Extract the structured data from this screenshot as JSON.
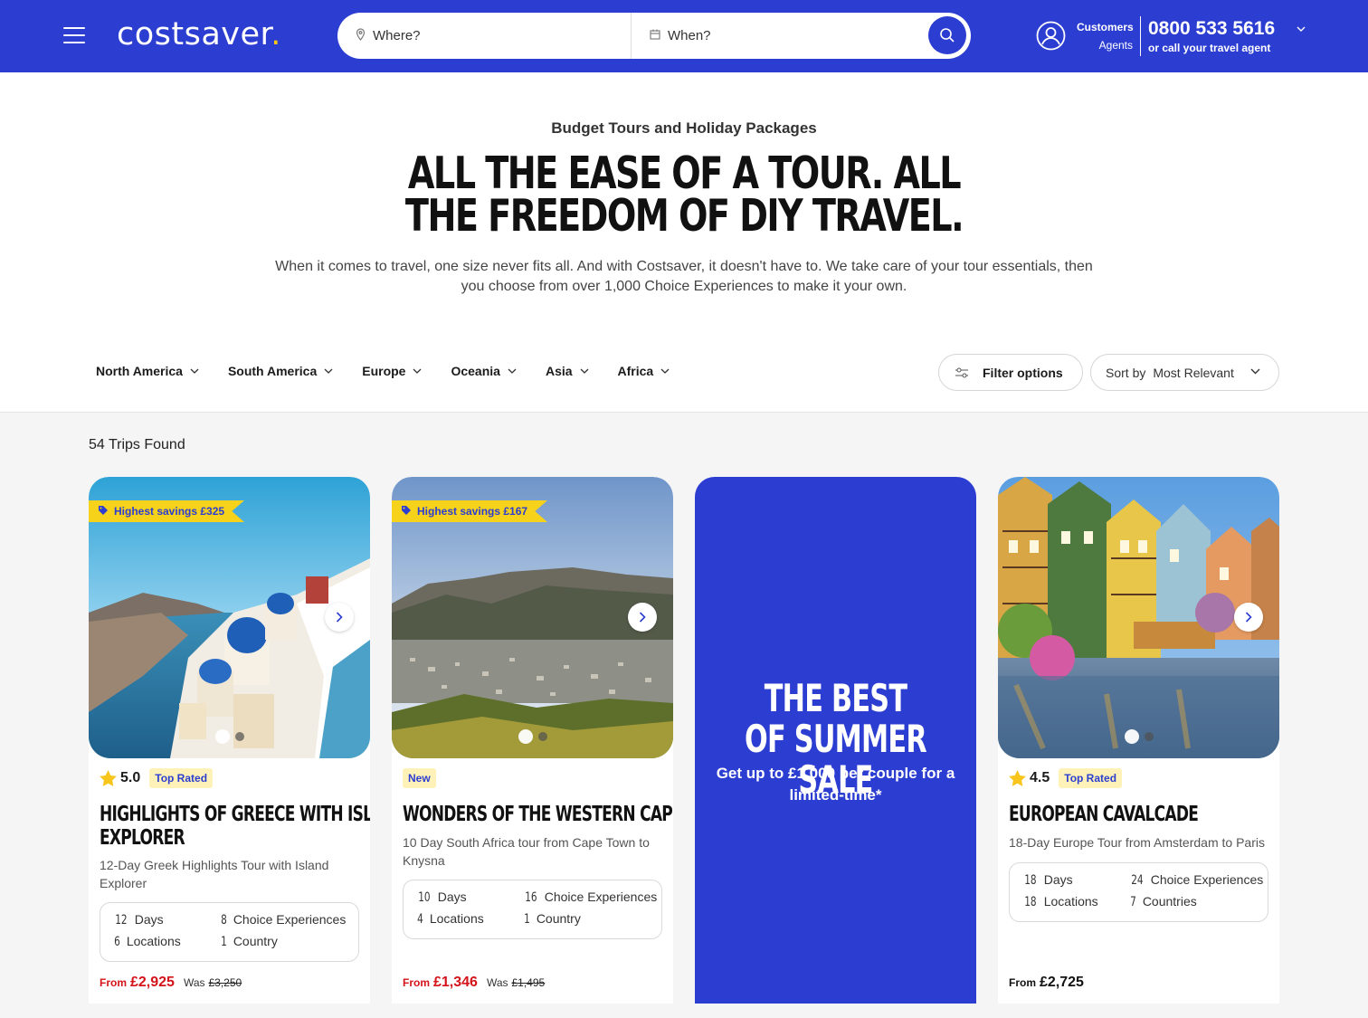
{
  "header": {
    "logo_text": "costsaver",
    "logo_dot": ".",
    "search": {
      "where_placeholder": "Where?",
      "when_placeholder": "When?"
    },
    "customers_label": "Customers",
    "agents_label": "Agents",
    "phone": "0800 533 5616",
    "phone_sub": "or call your travel agent"
  },
  "hero": {
    "eyebrow": "Budget Tours and Holiday Packages",
    "headline": "ALL THE EASE OF A TOUR. ALL THE FREEDOM OF DIY TRAVEL.",
    "lede": "When it comes to travel, one size never fits all. And with Costsaver, it doesn't have to. We take care of your tour essentials, then you choose from over 1,000 Choice Experiences to make it your own."
  },
  "filters": {
    "regions": [
      "North America",
      "South America",
      "Europe",
      "Oceania",
      "Asia",
      "Africa"
    ],
    "filter_label": "Filter options",
    "sort_label": "Sort by",
    "sort_value": "Most Relevant"
  },
  "results": {
    "count_label": "54 Trips Found",
    "cards": [
      {
        "ribbon": "Highest savings £325",
        "rating": "5.0",
        "badge": "Top Rated",
        "title_line1": "HIGHLIGHTS OF GREECE WITH ISLAND",
        "title_line2": "EXPLORER",
        "subtitle": "12-Day Greek Highlights Tour with Island Explorer",
        "days": "12",
        "days_label": "Days",
        "choice": "8",
        "choice_label": "Choice Experiences",
        "locations": "6",
        "locations_label": "Locations",
        "countries": "1",
        "countries_label": "Country",
        "from_label": "From",
        "price": "£2,925",
        "was_label": "Was",
        "was_price": "£3,250"
      },
      {
        "ribbon": "Highest savings £167",
        "badge": "New",
        "title_line1": "WONDERS OF THE WESTERN CAPE",
        "subtitle": "10 Day South Africa tour from Cape Town to Knysna",
        "days": "10",
        "days_label": "Days",
        "choice": "16",
        "choice_label": "Choice Experiences",
        "locations": "4",
        "locations_label": "Locations",
        "countries": "1",
        "countries_label": "Country",
        "from_label": "From",
        "price": "£1,346",
        "was_label": "Was",
        "was_price": "£1,495"
      },
      {
        "rating": "4.5",
        "badge": "Top Rated",
        "title_line1": "EUROPEAN CAVALCADE",
        "subtitle": "18-Day Europe Tour from Amsterdam to Paris",
        "days": "18",
        "days_label": "Days",
        "choice": "24",
        "choice_label": "Choice Experiences",
        "locations": "18",
        "locations_label": "Locations",
        "countries": "7",
        "countries_label": "Countries",
        "from_label": "From",
        "price": "£2,725"
      }
    ],
    "promo": {
      "title": "THE BEST OF SUMMER SALE",
      "subtitle": "Get up to £1,000 per couple for a limited-time*"
    }
  },
  "colors": {
    "brand_blue": "#2c3dd1",
    "accent_yellow": "#f7d21b",
    "price_red": "#d4131a"
  }
}
